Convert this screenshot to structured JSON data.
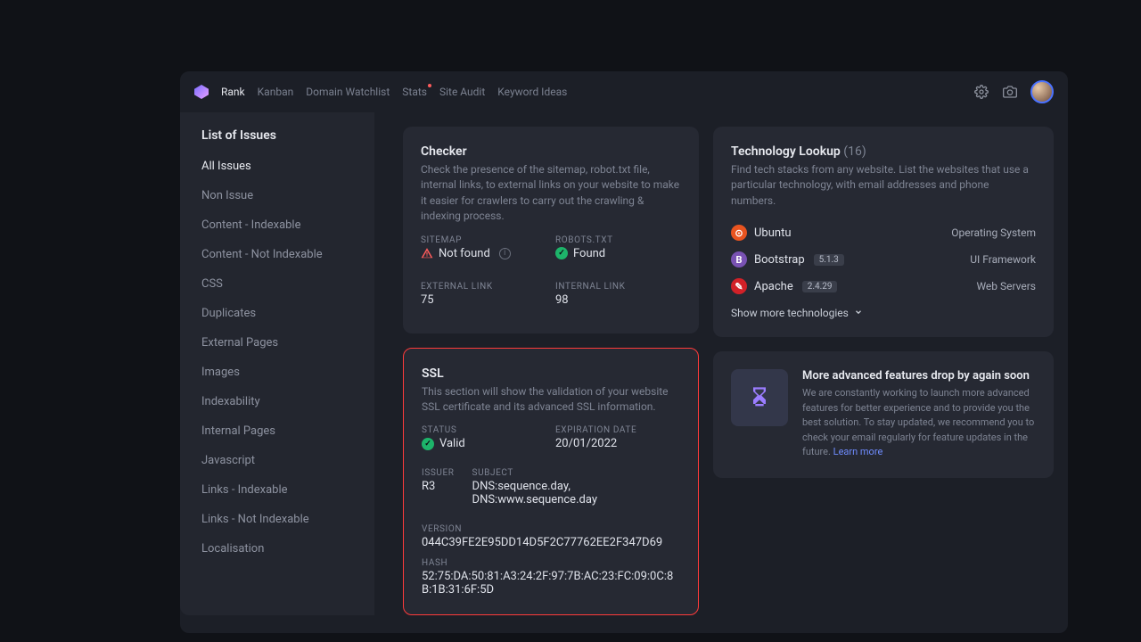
{
  "nav": {
    "items": [
      "Rank",
      "Kanban",
      "Domain Watchlist",
      "Stats",
      "Site Audit",
      "Keyword Ideas"
    ],
    "active": "Rank",
    "dotted": "Stats"
  },
  "sidebar": {
    "title": "List of Issues",
    "items": [
      "All Issues",
      "Non Issue",
      "Content - Indexable",
      "Content - Not Indexable",
      "CSS",
      "Duplicates",
      "External Pages",
      "Images",
      "Indexability",
      "Internal Pages",
      "Javascript",
      "Links - Indexable",
      "Links - Not Indexable",
      "Localisation"
    ],
    "active": "All Issues"
  },
  "checker": {
    "title": "Checker",
    "desc": "Check the presence of the sitemap, robot.txt file, internal links, to external links on your website to make it easier for crawlers to carry out the crawling & indexing process.",
    "sitemap": {
      "label": "SITEMAP",
      "value": "Not found",
      "status": "warn"
    },
    "robots": {
      "label": "ROBOTS.TXT",
      "value": "Found",
      "status": "ok"
    },
    "external": {
      "label": "EXTERNAL LINK",
      "value": "75"
    },
    "internal": {
      "label": "INTERNAL LINK",
      "value": "98"
    }
  },
  "ssl": {
    "title": "SSL",
    "desc": "This section will show the validation of your website SSL certificate and its advanced SSL information.",
    "status": {
      "label": "STATUS",
      "value": "Valid",
      "icon": "ok"
    },
    "expires": {
      "label": "EXPIRATION DATE",
      "value": "20/01/2022"
    },
    "issuer": {
      "label": "ISSUER",
      "value": "R3"
    },
    "subject": {
      "label": "SUBJECT",
      "value": "DNS:sequence.day, DNS:www.sequence.day"
    },
    "version": {
      "label": "VERSION",
      "value": "044C39FE2E95DD14D5F2C77762EE2F347D69"
    },
    "hash": {
      "label": "HASH",
      "value": "52:75:DA:50:81:A3:24:2F:97:7B:AC:23:FC:09:0C:8B:1B:31:6F:5D"
    }
  },
  "tech": {
    "title": "Technology Lookup",
    "count": "(16)",
    "desc": "Find tech stacks from any website. List the websites that use a particular technology, with email addresses and phone numbers.",
    "items": [
      {
        "name": "Ubuntu",
        "version": "",
        "category": "Operating System",
        "color": "#e95420",
        "glyph": "⊙"
      },
      {
        "name": "Bootstrap",
        "version": "5.1.3",
        "category": "UI Framework",
        "color": "#7952b3",
        "glyph": "B"
      },
      {
        "name": "Apache",
        "version": "2.4.29",
        "category": "Web Servers",
        "color": "#d22128",
        "glyph": "✎"
      }
    ],
    "more": "Show more technologies"
  },
  "promo": {
    "title": "More advanced features drop by again soon",
    "body": "We are constantly working to launch more advanced features for better experience and to provide you the best solution. To stay updated, we recommend you to check your email regularly for feature updates in the future. ",
    "link": "Learn more"
  }
}
